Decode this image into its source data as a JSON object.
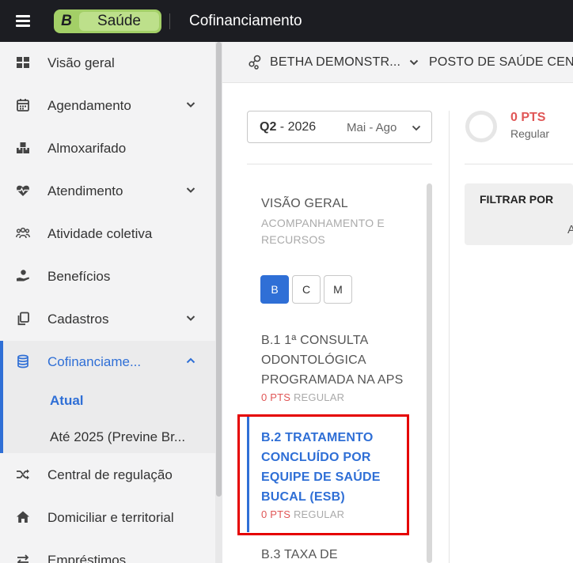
{
  "header": {
    "app_letter": "B",
    "app_name": "Saúde",
    "title": "Cofinanciamento"
  },
  "sidebar": {
    "items": [
      {
        "label": "Visão geral",
        "icon": "dashboard-icon",
        "has_chevron": false
      },
      {
        "label": "Agendamento",
        "icon": "calendar-icon",
        "has_chevron": true
      },
      {
        "label": "Almoxarifado",
        "icon": "boxes-icon",
        "has_chevron": false
      },
      {
        "label": "Atendimento",
        "icon": "heart-pulse-icon",
        "has_chevron": true
      },
      {
        "label": "Atividade coletiva",
        "icon": "people-group-icon",
        "has_chevron": false
      },
      {
        "label": "Benefícios",
        "icon": "hand-holding-icon",
        "has_chevron": false
      },
      {
        "label": "Cadastros",
        "icon": "copy-icon",
        "has_chevron": true
      },
      {
        "label": "Cofinanciame...",
        "icon": "database-icon",
        "has_chevron": true,
        "active": true
      },
      {
        "label": "Central de regulação",
        "icon": "shuffle-icon",
        "has_chevron": false
      },
      {
        "label": "Domiciliar e territorial",
        "icon": "home-icon",
        "has_chevron": false
      },
      {
        "label": "Empréstimos",
        "icon": "exchange-icon",
        "has_chevron": false
      }
    ],
    "subitems": [
      {
        "label": "Atual",
        "active": true
      },
      {
        "label": "Até 2025 (Previne Br..."
      }
    ]
  },
  "filterbar": {
    "entity": "BETHA DEMONSTR...",
    "unit": "POSTO DE SAÚDE CEN"
  },
  "quarter": {
    "code": "Q2",
    "year": " - 2026",
    "range": "Mai - Ago"
  },
  "score": {
    "pts": "0 PTS",
    "status": "Regular"
  },
  "filter_panel": {
    "label": "FILTRAR POR",
    "cut_text": "A"
  },
  "list": {
    "heading": "VISÃO GERAL",
    "subheading": "ACOMPANHAMENTO E RECURSOS",
    "tabs": [
      "B",
      "C",
      "M"
    ],
    "indicators": [
      {
        "title": "B.1 1ª CONSULTA ODONTOLÓGICA PROGRAMADA NA APS",
        "pts": "0 PTS",
        "status": "REGULAR"
      },
      {
        "title": "B.2 TRATAMENTO CONCLUÍDO POR EQUIPE DE SAÚDE BUCAL (ESB)",
        "pts": "0 PTS",
        "status": "REGULAR"
      },
      {
        "title": "B.3 TAXA DE"
      }
    ]
  },
  "colors": {
    "accent": "#2f6fd6",
    "points": "#e05656",
    "highlight": "#e50000",
    "topbar": "#1c1d22",
    "brand": "#a3cf67"
  }
}
